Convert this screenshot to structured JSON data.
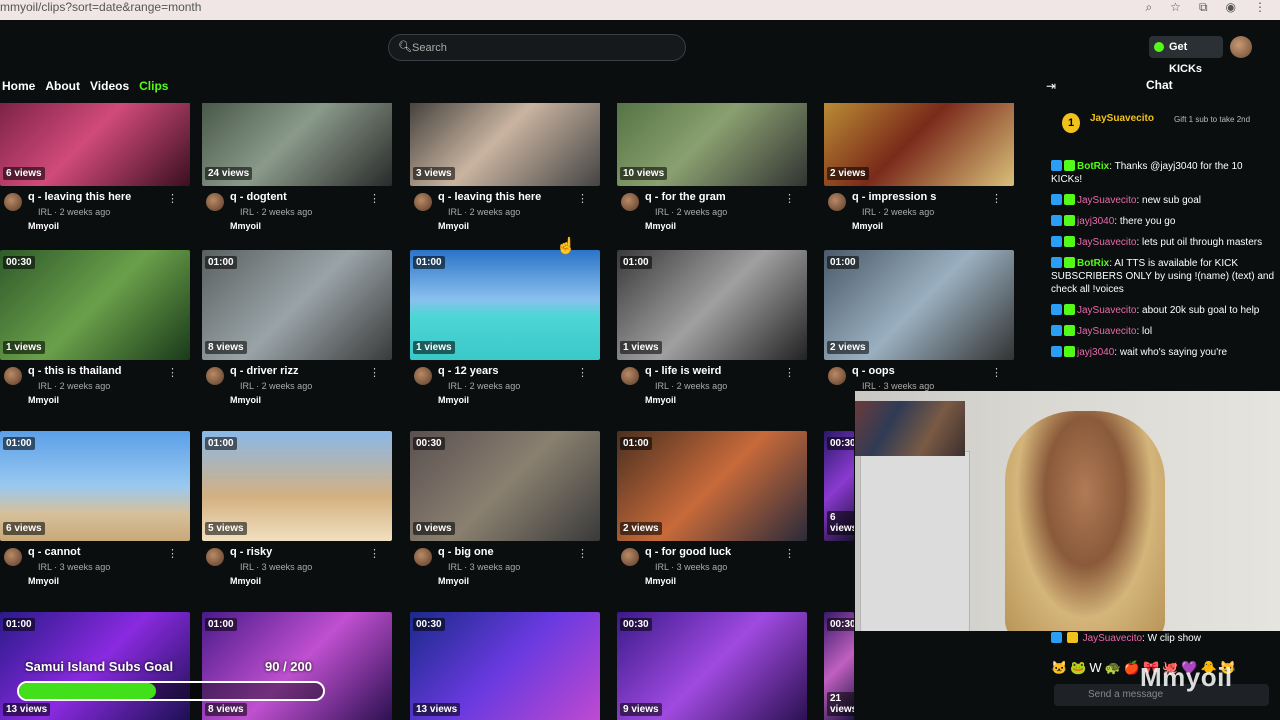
{
  "browser": {
    "url": "mmyoil/clips?sort=date&range=month",
    "icons": [
      "zoom-icon",
      "star-icon",
      "extension-icon",
      "profile-icon",
      "menu-icon"
    ]
  },
  "header": {
    "search_placeholder": "Search",
    "get_kicks_label": "Get KICKs"
  },
  "nav": {
    "items": [
      "Home",
      "About",
      "Videos",
      "Clips"
    ],
    "active": "Clips"
  },
  "clips": [
    {
      "title": "q - leaving this here",
      "views": "6 views",
      "duration": "",
      "meta": "IRL · 2 weeks ago",
      "author": "Mmyoil"
    },
    {
      "title": "q - dogtent",
      "views": "24 views",
      "duration": "",
      "meta": "IRL · 2 weeks ago",
      "author": "Mmyoil"
    },
    {
      "title": "q - leaving this here",
      "views": "3 views",
      "duration": "",
      "meta": "IRL · 2 weeks ago",
      "author": "Mmyoil"
    },
    {
      "title": "q - for the gram",
      "views": "10 views",
      "duration": "",
      "meta": "IRL · 2 weeks ago",
      "author": "Mmyoil"
    },
    {
      "title": "q - impression s",
      "views": "2 views",
      "duration": "",
      "meta": "IRL · 2 weeks ago",
      "author": "Mmyoil"
    },
    {
      "title": "q - this is thailand",
      "views": "1 views",
      "duration": "00:30",
      "meta": "IRL · 2 weeks ago",
      "author": "Mmyoil"
    },
    {
      "title": "q - driver rizz",
      "views": "8 views",
      "duration": "01:00",
      "meta": "IRL · 2 weeks ago",
      "author": "Mmyoil"
    },
    {
      "title": "q - 12 years",
      "views": "1 views",
      "duration": "01:00",
      "meta": "IRL · 2 weeks ago",
      "author": "Mmyoil"
    },
    {
      "title": "q - life is weird",
      "views": "1 views",
      "duration": "01:00",
      "meta": "IRL · 2 weeks ago",
      "author": "Mmyoil"
    },
    {
      "title": "q - oops",
      "views": "2 views",
      "duration": "01:00",
      "meta": "IRL · 3 weeks ago",
      "author": ""
    },
    {
      "title": "q - cannot",
      "views": "6 views",
      "duration": "01:00",
      "meta": "IRL · 3 weeks ago",
      "author": "Mmyoil"
    },
    {
      "title": "q - risky",
      "views": "5 views",
      "duration": "01:00",
      "meta": "IRL · 3 weeks ago",
      "author": "Mmyoil"
    },
    {
      "title": "q - big one",
      "views": "0 views",
      "duration": "00:30",
      "meta": "IRL · 3 weeks ago",
      "author": "Mmyoil"
    },
    {
      "title": "q - for good luck",
      "views": "2 views",
      "duration": "01:00",
      "meta": "IRL · 3 weeks ago",
      "author": "Mmyoil"
    },
    {
      "title": "",
      "views": "6 views",
      "duration": "00:30",
      "meta": "",
      "author": ""
    },
    {
      "title": "",
      "views": "13 views",
      "duration": "01:00",
      "meta": "",
      "author": ""
    },
    {
      "title": "",
      "views": "8 views",
      "duration": "01:00",
      "meta": "",
      "author": ""
    },
    {
      "title": "",
      "views": "13 views",
      "duration": "00:30",
      "meta": "",
      "author": ""
    },
    {
      "title": "",
      "views": "9 views",
      "duration": "00:30",
      "meta": "",
      "author": ""
    },
    {
      "title": "",
      "views": "21 views",
      "duration": "00:30",
      "meta": "",
      "author": ""
    }
  ],
  "chat": {
    "title": "Chat",
    "pinned": {
      "rank": "1",
      "name": "JaySuavecito",
      "gift_text": "Gift 1 sub to take 2nd"
    },
    "messages": [
      {
        "user": "BotRix",
        "text": ": Thanks @jayj3040 for the 10 KICKs!"
      },
      {
        "user": "JaySuavecito",
        "text": ": new sub goal"
      },
      {
        "user": "jayj3040",
        "text": ": there you go"
      },
      {
        "user": "JaySuavecito",
        "text": ": lets put oil through masters"
      },
      {
        "user": "BotRix",
        "text": ": AI TTS is available for KICK SUBSCRIBERS ONLY by using !(name) (text) and check all !voices"
      },
      {
        "user": "JaySuavecito",
        "text": ": about 20k sub goal to help"
      },
      {
        "user": "JaySuavecito",
        "text": ": lol"
      },
      {
        "user": "jayj3040",
        "text": ": wait who's saying you're"
      }
    ],
    "last_message": {
      "user": "JaySuavecito",
      "text": ": W clip show"
    },
    "send_placeholder": "Send a message"
  },
  "overlay": {
    "goal_title": "Samui Island Subs Goal",
    "goal_count": "90 / 200",
    "goal_progress": 0.45,
    "watermark": "Mmyoil"
  },
  "colors": {
    "accent": "#53fc18",
    "gold": "#f1c21b",
    "pink": "#e96baa"
  }
}
